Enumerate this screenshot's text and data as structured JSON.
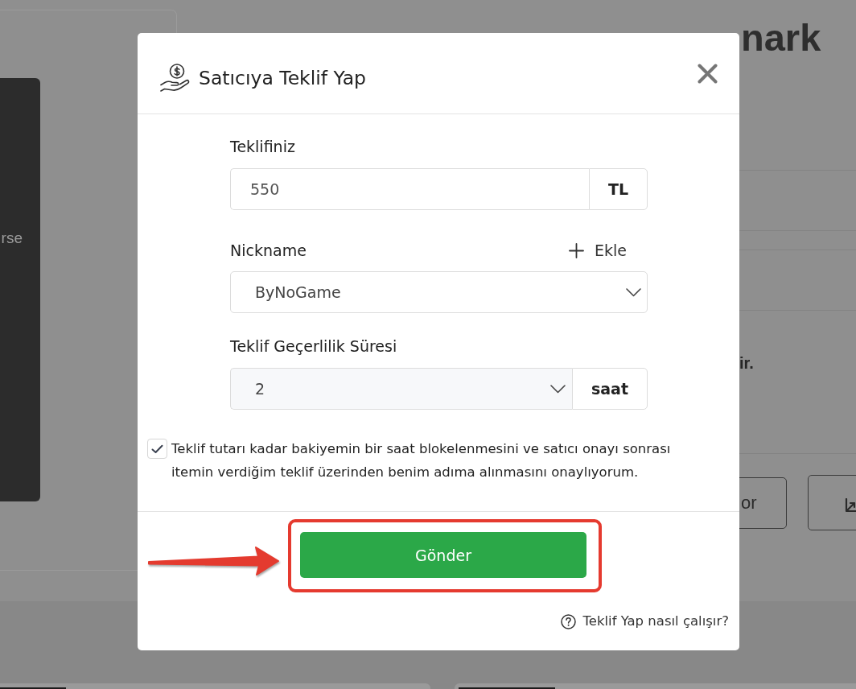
{
  "background": {
    "panel_text": "rse",
    "title_fragment": "nark",
    "notice_text": "ir.",
    "action_label": "or"
  },
  "modal": {
    "title": "Satıcıya Teklif Yap",
    "offer": {
      "label": "Teklifiniz",
      "value": "550",
      "unit": "TL"
    },
    "nickname": {
      "label": "Nickname",
      "add_label": "Ekle",
      "value": "ByNoGame"
    },
    "validity": {
      "label": "Teklif Geçerlilik Süresi",
      "value": "2",
      "unit": "saat"
    },
    "consent": {
      "checked": true,
      "text": "Teklif tutarı kadar bakiyemin bir saat blokelenmesini ve satıcı onayı sonrası itemin verdiğim teklif üzerinden benim adıma alınmasını onaylıyorum."
    },
    "submit": "Gönder",
    "help_link": "Teklif Yap nasıl çalışır?"
  },
  "annotations": {
    "arrow": true,
    "frame": true
  }
}
